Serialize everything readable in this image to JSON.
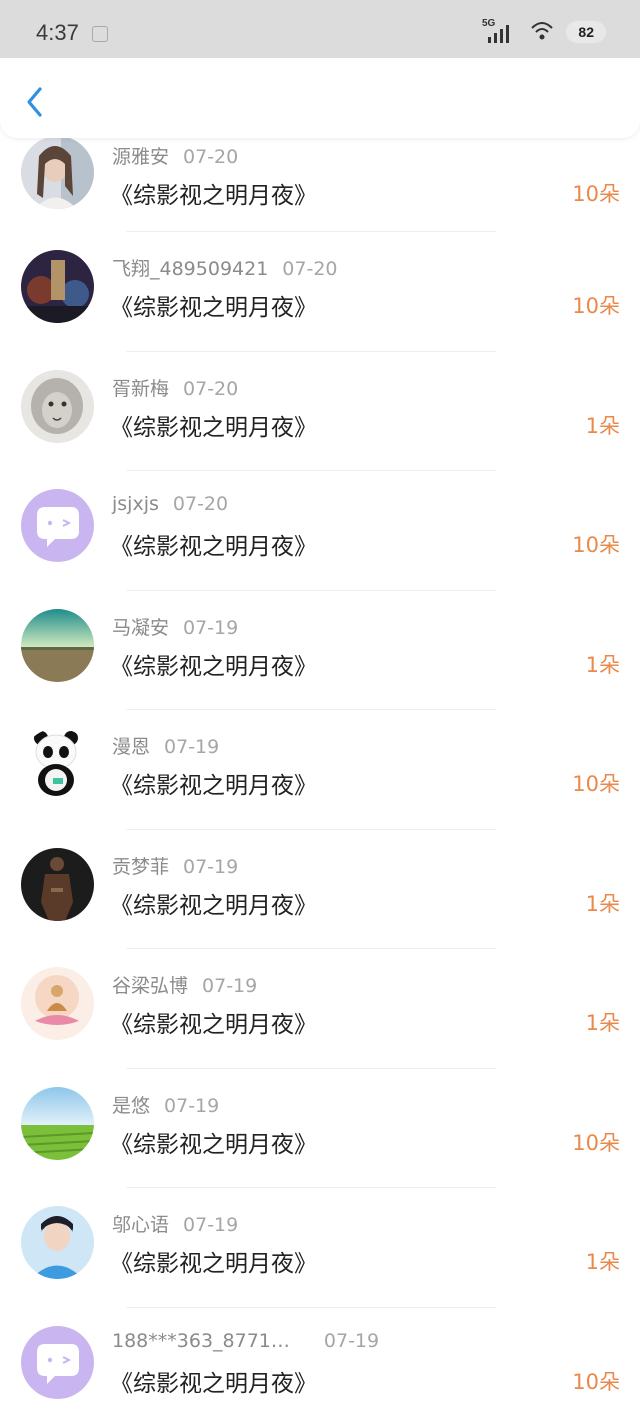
{
  "status_bar": {
    "time": "4:37",
    "network": "5G",
    "battery": "82"
  },
  "nav": {
    "back_icon": "chevron-left-icon",
    "accent": "#2f8fe0"
  },
  "colors": {
    "amount": "#e9894a",
    "name": "#8b8b8b",
    "date": "#a6a6a6",
    "title": "#222222",
    "avatar_default_bg": "#c9b6f0"
  },
  "items": [
    {
      "name": "源雅安",
      "date": "07-20",
      "title": "《综影视之明月夜》",
      "amount": "10朵",
      "avatar": "woman-photo"
    },
    {
      "name": "飞翔_489509421",
      "date": "07-20",
      "title": "《综影视之明月夜》",
      "amount": "10朵",
      "avatar": "poster-art"
    },
    {
      "name": "胥新梅",
      "date": "07-20",
      "title": "《综影视之明月夜》",
      "amount": "1朵",
      "avatar": "lion-sketch"
    },
    {
      "name": "jsjxjs",
      "date": "07-20",
      "title": "《综影视之明月夜》",
      "amount": "10朵",
      "avatar": "default-chat"
    },
    {
      "name": "马凝安",
      "date": "07-19",
      "title": "《综影视之明月夜》",
      "amount": "1朵",
      "avatar": "field-landscape"
    },
    {
      "name": "漫恩",
      "date": "07-19",
      "title": "《综影视之明月夜》",
      "amount": "10朵",
      "avatar": "panda-plush"
    },
    {
      "name": "贡梦菲",
      "date": "07-19",
      "title": "《综影视之明月夜》",
      "amount": "1朵",
      "avatar": "warrior-figure"
    },
    {
      "name": "谷梁弘博",
      "date": "07-19",
      "title": "《综影视之明月夜》",
      "amount": "1朵",
      "avatar": "buddha-lotus"
    },
    {
      "name": "是悠",
      "date": "07-19",
      "title": "《综影视之明月夜》",
      "amount": "10朵",
      "avatar": "green-field"
    },
    {
      "name": "邬心语",
      "date": "07-19",
      "title": "《综影视之明月夜》",
      "amount": "1朵",
      "avatar": "boy-portrait"
    },
    {
      "name": "188***363_8771…",
      "date": "07-19",
      "title": "《综影视之明月夜》",
      "amount": "10朵",
      "avatar": "default-chat"
    }
  ]
}
